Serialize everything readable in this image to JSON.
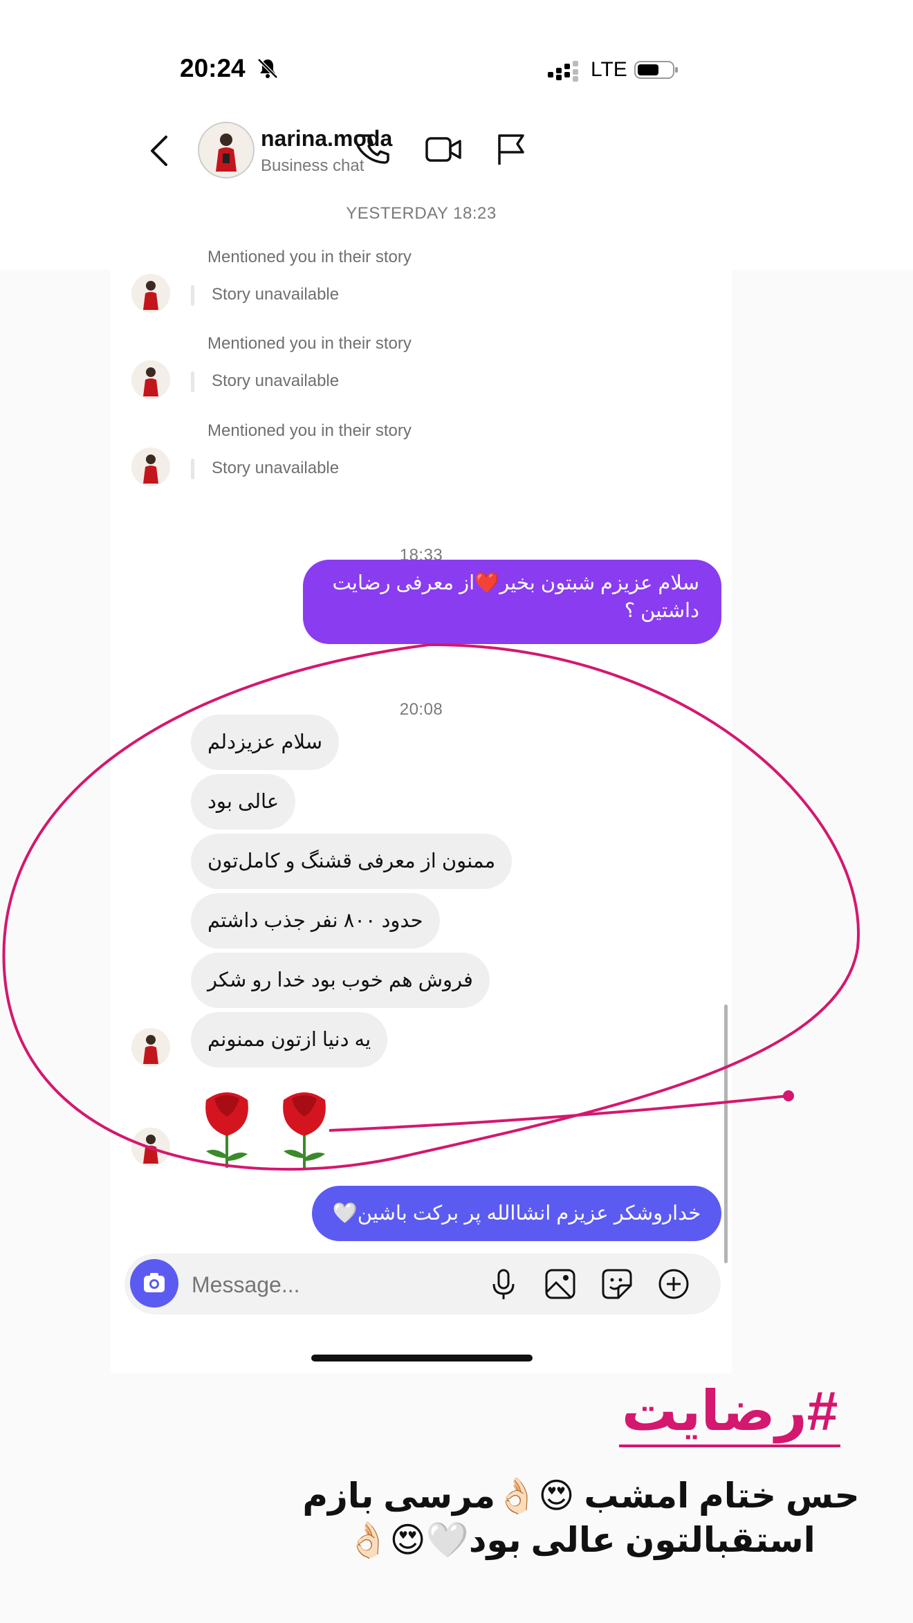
{
  "status_bar": {
    "time": "20:24",
    "network": "LTE"
  },
  "header": {
    "username": "narina.moda",
    "subtitle": "Business chat"
  },
  "conversation": {
    "timestamp_1": "YESTERDAY 18:23",
    "story_mentions": [
      {
        "mention": "Mentioned you in their story",
        "story": "Story unavailable"
      },
      {
        "mention": "Mentioned you in their story",
        "story": "Story unavailable"
      },
      {
        "mention": "Mentioned you in their story",
        "story": "Story unavailable"
      }
    ],
    "timestamp_2": "18:33",
    "sent_message_1": "سلام عزیزم شبتون بخیر❤️از معرفی رضایت داشتین ؟",
    "timestamp_3": "20:08",
    "received_messages": [
      "سلام عزیزدلم",
      "عالی بود",
      "ممنون از معرفی قشنگ و کامل‌تون",
      "حدود ۸۰۰ نفر جذب داشتم",
      "فروش هم خوب بود خدا رو شکر",
      "یه دنیا ازتون ممنونم"
    ],
    "sent_message_2": "خداروشکر عزیزم انشاالله پر برکت باشین🤍"
  },
  "composer": {
    "placeholder": "Message..."
  },
  "overlay": {
    "hashtag": "#رضایت",
    "caption_line_1": "حس ختام امشب 😍👌🏻مرسی بازم",
    "caption_line_2": "استقبالتون عالی بود🤍😍👌🏻",
    "accent_color": "#d4176f"
  },
  "colors": {
    "sent_bubble": "#8a3cf0",
    "sent_bubble_2": "#5b5bf2",
    "received_bubble": "#efefef"
  }
}
